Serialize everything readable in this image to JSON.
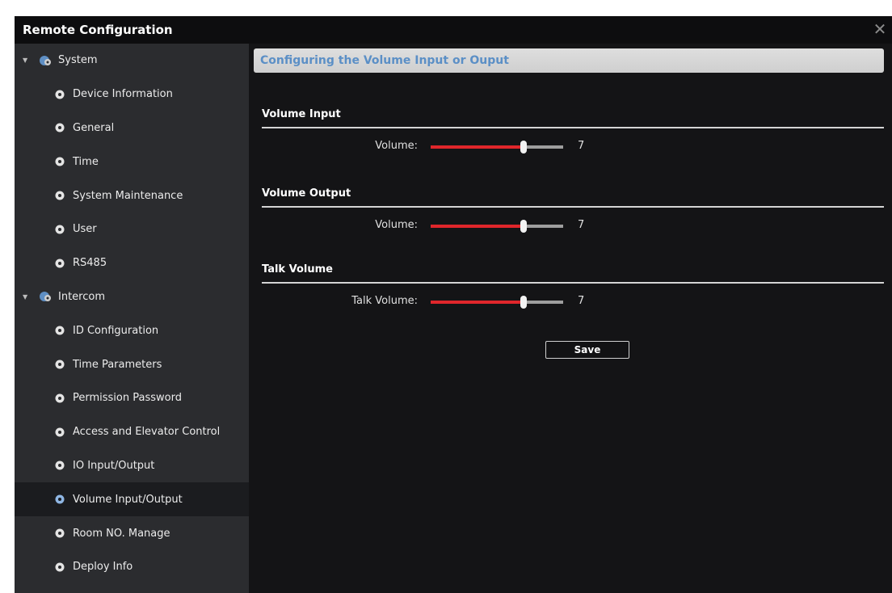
{
  "window": {
    "title": "Remote Configuration",
    "close_icon": "close-icon"
  },
  "sidebar": {
    "groups": [
      {
        "label": "System",
        "expanded": true,
        "items": [
          {
            "label": "Device Information"
          },
          {
            "label": "General"
          },
          {
            "label": "Time"
          },
          {
            "label": "System Maintenance"
          },
          {
            "label": "User"
          },
          {
            "label": "RS485"
          }
        ]
      },
      {
        "label": "Intercom",
        "expanded": true,
        "items": [
          {
            "label": "ID Configuration"
          },
          {
            "label": "Time Parameters"
          },
          {
            "label": "Permission Password"
          },
          {
            "label": "Access and Elevator Control"
          },
          {
            "label": "IO Input/Output"
          },
          {
            "label": "Volume Input/Output",
            "selected": true
          },
          {
            "label": "Room NO. Manage"
          },
          {
            "label": "Deploy Info"
          }
        ]
      }
    ]
  },
  "content": {
    "header": "Configuring the Volume Input or Ouput",
    "sections": [
      {
        "title": "Volume Input",
        "label": "Volume:",
        "value": "7",
        "level": 0.7
      },
      {
        "title": "Volume Output",
        "label": "Volume:",
        "value": "7",
        "level": 0.7
      },
      {
        "title": "Talk Volume",
        "label": "Talk Volume:",
        "value": "7",
        "level": 0.7
      }
    ],
    "save_label": "Save"
  },
  "colors": {
    "slider_fill": "#e0262b",
    "slider_track": "#9e9e9e",
    "header_text": "#5b8fc6",
    "selected_item_bg": "#1b1c1f"
  }
}
